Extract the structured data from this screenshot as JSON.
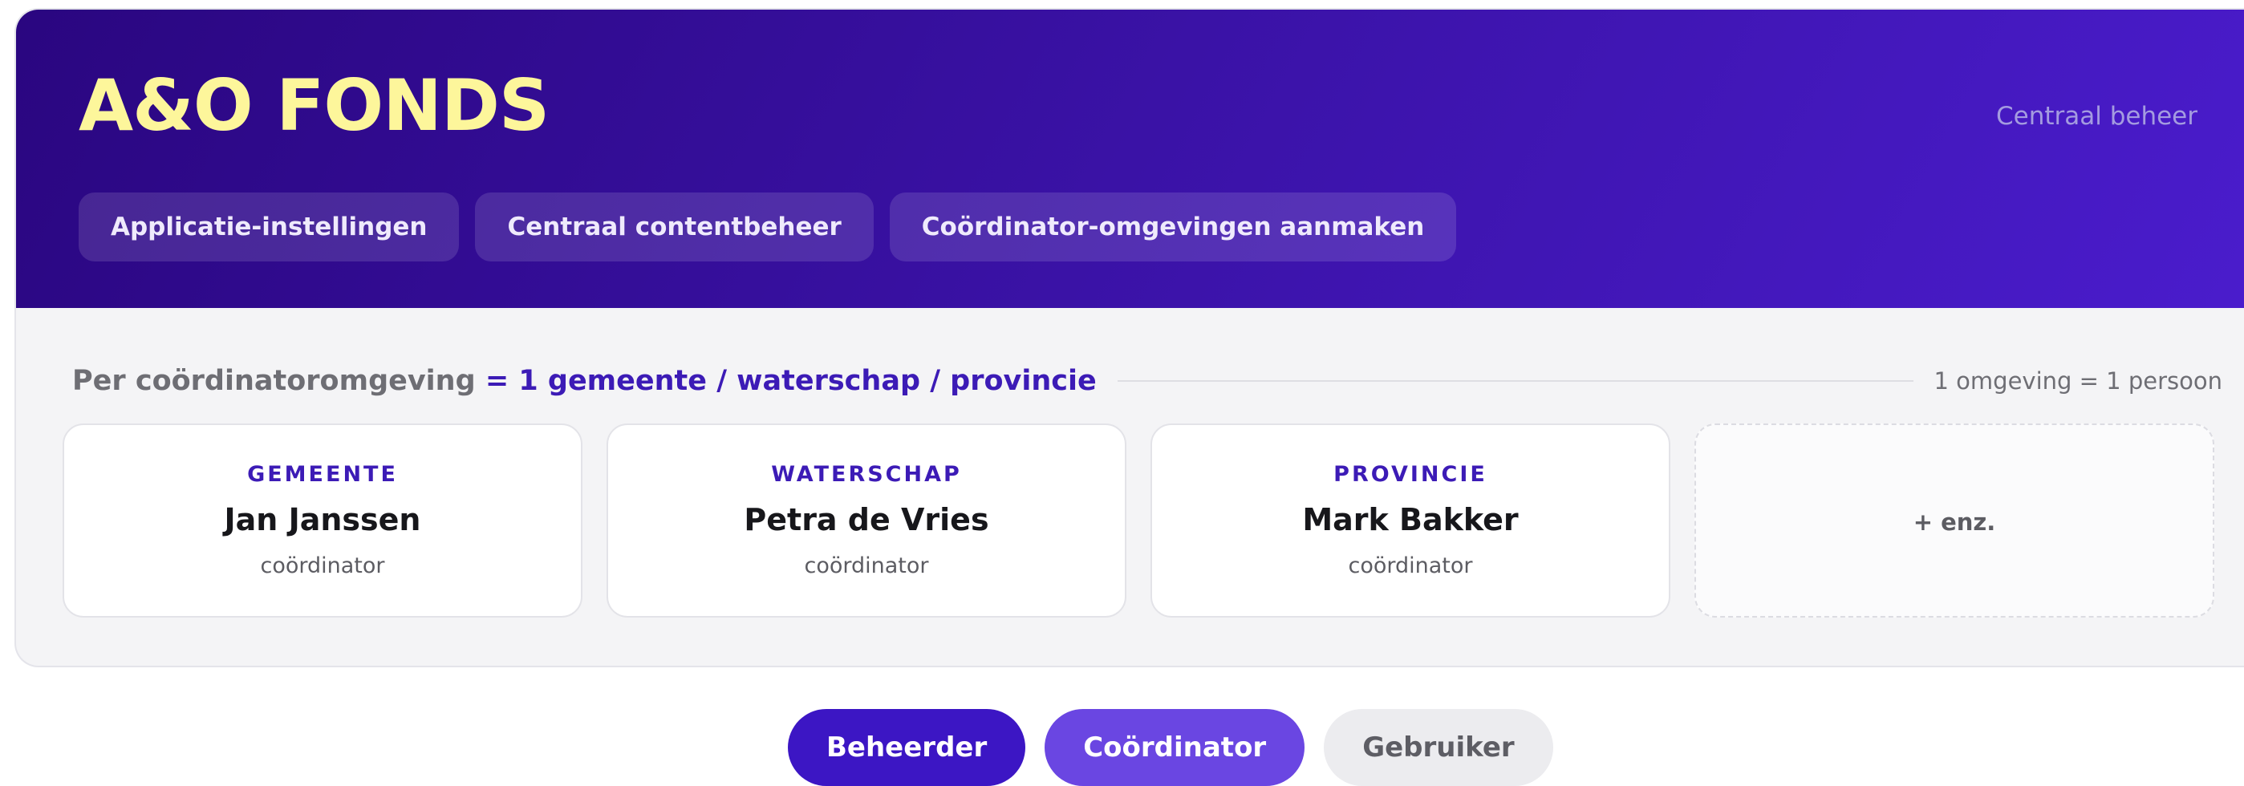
{
  "header": {
    "logo": "A&O FONDS",
    "right_label": "Centraal beheer",
    "tabs": [
      {
        "label": "Applicatie-instellingen"
      },
      {
        "label": "Centraal contentbeheer"
      },
      {
        "label": "Coördinator-omgevingen aanmaken"
      }
    ]
  },
  "section": {
    "title_prefix": "Per coördinatoromgeving ",
    "title_accent": "= 1 gemeente / waterschap / provincie",
    "note": "1 omgeving = 1 persoon"
  },
  "cards": [
    {
      "type": "GEMEENTE",
      "name": "Jan Janssen",
      "role": "coördinator"
    },
    {
      "type": "WATERSCHAP",
      "name": "Petra de Vries",
      "role": "coördinator"
    },
    {
      "type": "PROVINCIE",
      "name": "Mark Bakker",
      "role": "coördinator"
    }
  ],
  "more_card": {
    "label": "+ enz."
  },
  "role_toggle": {
    "beheerder": "Beheerder",
    "coordinator": "Coördinator",
    "gebruiker": "Gebruiker"
  },
  "colors": {
    "header_gradient_start": "#2a0680",
    "header_gradient_end": "#4a1ccc",
    "logo_yellow": "#fdf69b",
    "accent_purple": "#3c1bb6",
    "coordinator_purple": "#6a46e2"
  }
}
